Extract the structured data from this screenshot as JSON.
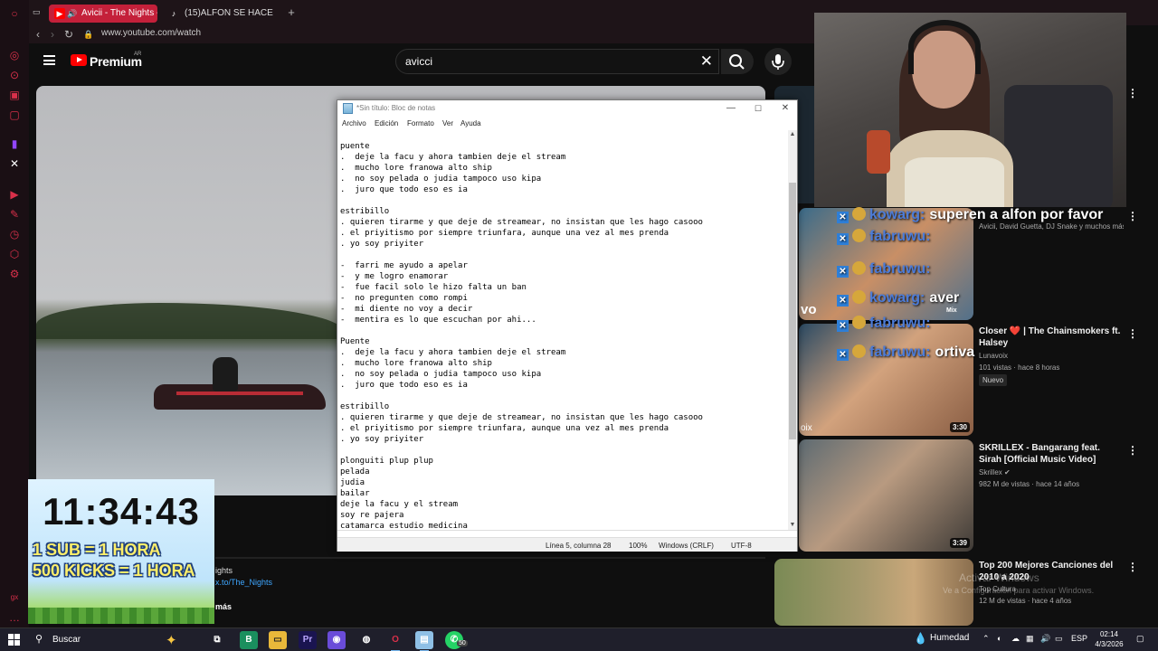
{
  "browser": {
    "tabs": [
      {
        "label": "Avicii - The Nights - Yo",
        "icon": "youtube-icon",
        "active": true
      },
      {
        "label": "(15)ALFON SE HACE EL M",
        "icon": "tiktok-icon",
        "active": false
      }
    ],
    "url": "www.youtube.com/watch"
  },
  "youtube": {
    "brand": "Premium",
    "region": "AR",
    "search_value": "avicci",
    "description": {
      "handle": "ights",
      "link": "x.to/The_Nights",
      "more": "más"
    }
  },
  "notepad": {
    "title": "*Sin título: Bloc de notas",
    "menu": [
      "Archivo",
      "Edición",
      "Formato",
      "Ver",
      "Ayuda"
    ],
    "lines": [
      "puente",
      ".  deje la facu y ahora tambien deje el stream",
      ".  mucho lore franowa alto ship",
      ".  no soy pelada o judia tampoco uso kipa",
      ".  juro que todo eso es ia",
      "",
      "estribillo",
      ". quieren tirarme y que deje de streamear, no insistan que les hago casooo",
      ". el priyitismo por siempre triunfara, aunque una vez al mes prenda",
      ". yo soy priyiter",
      "",
      "-  farri me ayudo a apelar",
      "-  y me logro enamorar",
      "-  fue facil solo le hizo falta un ban",
      "-  no pregunten como rompi",
      "-  mi diente no voy a decir",
      "-  mentira es lo que escuchan por ahi...",
      "",
      "Puente",
      ".  deje la facu y ahora tambien deje el stream",
      ".  mucho lore franowa alto ship",
      ".  no soy pelada o judia tampoco uso kipa",
      ".  juro que todo eso es ia",
      "",
      "estribillo",
      ". quieren tirarme y que deje de streamear, no insistan que les hago casooo",
      ". el priyitismo por siempre triunfara, aunque una vez al mes prenda",
      ". yo soy priyiter",
      "",
      "plonguiti plup plup",
      "pelada",
      "judia",
      "bailar",
      "deje la facu y el stream",
      "soy re pajera",
      "catamarca estudio medicina"
    ],
    "status": {
      "position": "Línea 5, columna 28",
      "zoom": "100%",
      "line_ending": "Windows (CRLF)",
      "encoding": "UTF-8"
    }
  },
  "chat": [
    {
      "user": "kowarg:",
      "text": "superen a alfon por favor"
    },
    {
      "user": "fabruwu:",
      "text": ""
    },
    {
      "user": "fabruwu:",
      "text": ""
    },
    {
      "user": "kowarg:",
      "text": "aver"
    },
    {
      "user": "fabruwu:",
      "text": ""
    },
    {
      "user": "fabruwu:",
      "text": "ortiva"
    }
  ],
  "recommendations": [
    {
      "title": "",
      "channel": "Avicii, David Guetta, DJ Snake y muchos más",
      "meta": "",
      "duration": "",
      "mix_label": "Mix"
    },
    {
      "title": "Closer ❤️ | The Chainsmokers ft. Halsey",
      "channel": "Lunavoix",
      "meta": "101 vistas · hace 8 horas",
      "badge": "Nuevo",
      "duration": "3:30"
    },
    {
      "title": "SKRILLEX - Bangarang feat. Sirah [Official Music Video]",
      "channel": "Skrillex",
      "meta": "982 M de vistas · hace 14 años",
      "duration": "3:39"
    },
    {
      "title": "Top 200 Mejores Canciones del 2010 a 2020",
      "channel": "Top Cultura",
      "meta": "12 M de vistas · hace 4 años"
    }
  ],
  "shorts_partial_label": "vo",
  "overlay_thumb_labels": [
    "vo",
    "oix"
  ],
  "timer": {
    "clock": "11:34:43",
    "line1": "1 SUB = 1 HORA",
    "line2": "500 KICKS = 1 HORA"
  },
  "windows_watermark": {
    "line1": "Activar Windows",
    "line2": "Ve a Configuración para activar Windows."
  },
  "taskbar": {
    "search_placeholder": "Buscar",
    "whatsapp_badge": "50",
    "weather": "Humedad",
    "language": "ESP",
    "time": "02:14",
    "date": "4/3/2026"
  }
}
